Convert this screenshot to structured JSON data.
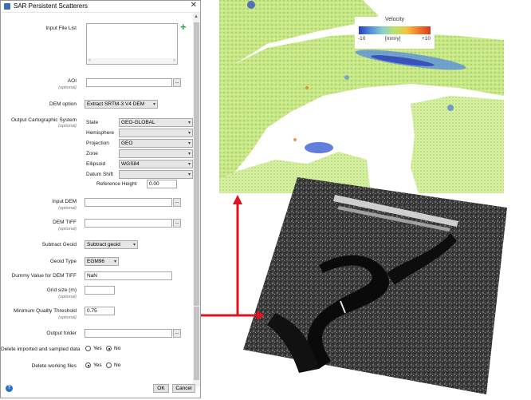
{
  "window": {
    "title": "SAR Persistent Scatterers",
    "close_glyph": "✕"
  },
  "form": {
    "input_file_list": {
      "label": "Input File List",
      "scroll_left": "<",
      "scroll_right": ">"
    },
    "aoi": {
      "label": "AOI",
      "optional": "(optional)",
      "value": "",
      "browse": "..."
    },
    "dem_option": {
      "label": "DEM option",
      "value": "Extract SRTM-3 V4 DEM"
    },
    "output_cartographic": {
      "label": "Output Cartographic System",
      "optional": "(optional)",
      "state": {
        "label": "State",
        "value": "GEO-GLOBAL"
      },
      "hemisphere": {
        "label": "Hemisphere",
        "value": ""
      },
      "projection": {
        "label": "Projection",
        "value": "GEO"
      },
      "zone": {
        "label": "Zone",
        "value": ""
      },
      "ellipsoid": {
        "label": "Ellipsoid",
        "value": "WGS84"
      },
      "datum_shift": {
        "label": "Datum Shift",
        "value": ""
      },
      "reference_height": {
        "label": "Reference Height",
        "value": "0.00"
      }
    },
    "input_dem": {
      "label": "Input DEM",
      "optional": "(optional)",
      "value": "",
      "browse": "..."
    },
    "dem_tiff": {
      "label": "DEM TIFF",
      "optional": "(optional)",
      "value": "",
      "browse": "..."
    },
    "subtract_geoid": {
      "label": "Subtract Geoid",
      "value": "Subtract geoid"
    },
    "geoid_type": {
      "label": "Geoid Type",
      "value": "EGM96"
    },
    "dummy_value": {
      "label": "Dummy Value for DEM TIFF",
      "value": "NaN"
    },
    "grid_size": {
      "label": "Grid size (m)",
      "optional": "(optional)",
      "value": ""
    },
    "min_quality": {
      "label": "Minimum Quality Threshold",
      "optional": "(optional)",
      "value": "0.75"
    },
    "output_folder": {
      "label": "Output folder",
      "value": "",
      "browse": "..."
    },
    "delete_imported": {
      "label": "Delete imported and sampled data",
      "yes": "Yes",
      "no": "No",
      "selected": "No"
    },
    "delete_working": {
      "label": "Delete working files",
      "yes": "Yes",
      "no": "No",
      "selected": "Yes"
    }
  },
  "footer": {
    "help": "?",
    "ok": "OK",
    "cancel": "Cancel"
  },
  "legend": {
    "title": "Velocity",
    "min": "-10",
    "unit": "[mm/y]",
    "max": "+10"
  },
  "colors": {
    "arrow": "#e0141e",
    "add_icon": "#27a84a",
    "help_icon": "#2a6fc9"
  }
}
